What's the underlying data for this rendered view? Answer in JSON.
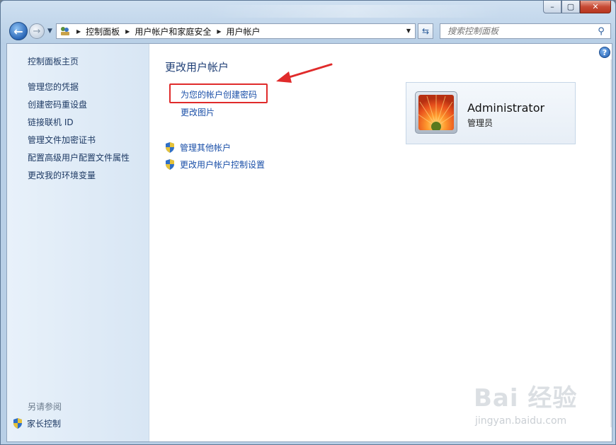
{
  "window": {
    "caption": {
      "min": "–",
      "max": "▢",
      "close": "✕"
    }
  },
  "nav": {
    "back_glyph": "←",
    "forward_glyph": "→",
    "breadcrumb": [
      "控制面板",
      "用户帐户和家庭安全",
      "用户帐户"
    ],
    "search_placeholder": "搜索控制面板"
  },
  "sidebar": {
    "home": "控制面板主页",
    "links": [
      "管理您的凭据",
      "创建密码重设盘",
      "链接联机 ID",
      "管理文件加密证书",
      "配置高级用户配置文件属性",
      "更改我的环境变量"
    ],
    "see_also_title": "另请参阅",
    "see_also_links": [
      "家长控制"
    ]
  },
  "main": {
    "title": "更改用户帐户",
    "tasks": [
      "为您的帐户创建密码",
      "更改图片"
    ],
    "shield_tasks": [
      "管理其他帐户",
      "更改用户帐户控制设置"
    ],
    "help_glyph": "?"
  },
  "user": {
    "name": "Administrator",
    "role": "管理员"
  },
  "watermark": {
    "logo": "Bai 经验",
    "url": "jingyan.baidu.com"
  },
  "colors": {
    "link": "#1a4fa8",
    "title": "#1f3f76",
    "highlight": "#e02b2b",
    "sidebar_bg": "#e2edf8"
  }
}
